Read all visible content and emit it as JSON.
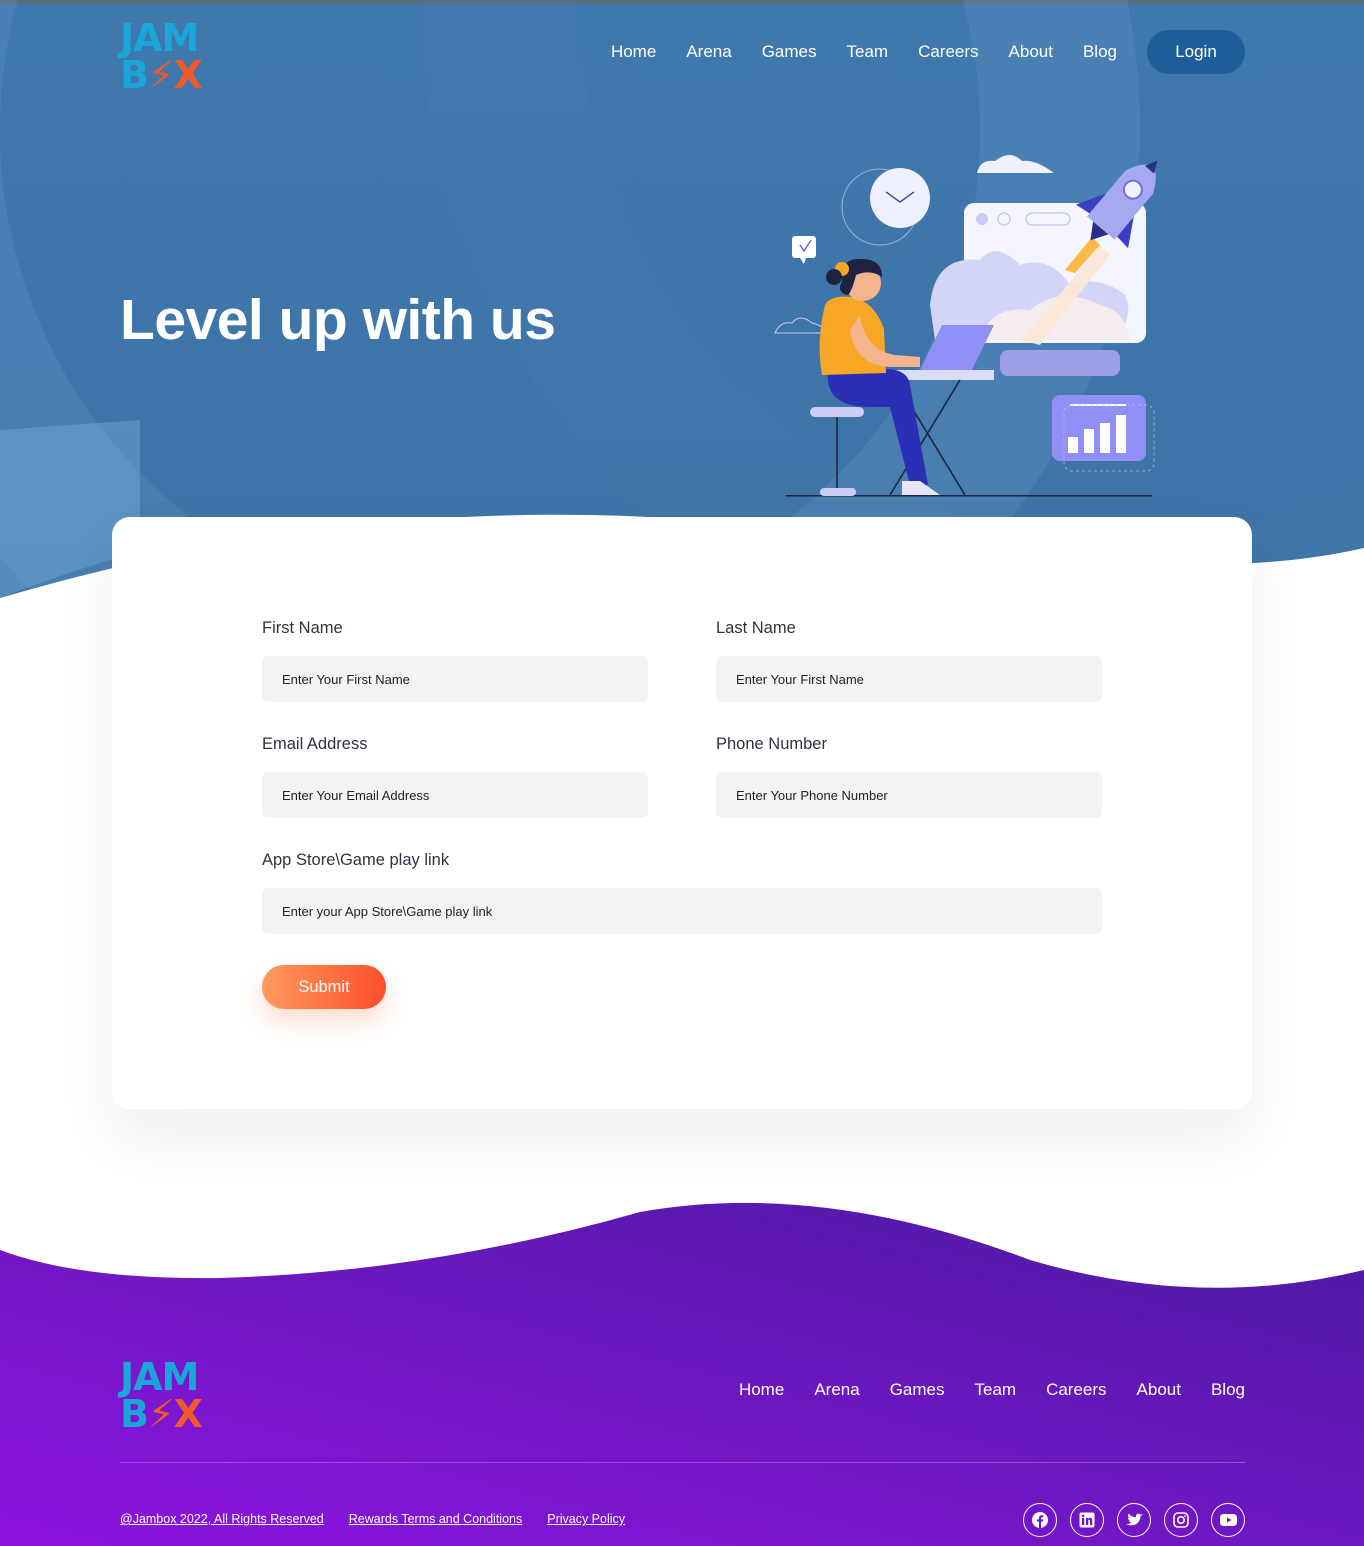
{
  "brand": {
    "line1": "JAM",
    "line2_b": "B",
    "line2_o": "⚡",
    "line2_x": "X"
  },
  "header": {
    "nav": [
      "Home",
      "Arena",
      "Games",
      "Team",
      "Careers",
      "About",
      "Blog"
    ],
    "login_label": "Login"
  },
  "hero": {
    "title": "Level up with us"
  },
  "form": {
    "first_name": {
      "label": "First Name",
      "placeholder": "Enter Your First Name"
    },
    "last_name": {
      "label": "Last Name",
      "placeholder": "Enter Your First Name"
    },
    "email": {
      "label": "Email Address",
      "placeholder": "Enter Your Email Address"
    },
    "phone": {
      "label": "Phone Number",
      "placeholder": "Enter Your Phone Number"
    },
    "app_link": {
      "label": "App Store\\Game play link",
      "placeholder": "Enter your App Store\\Game play link"
    },
    "submit_label": "Submit"
  },
  "footer": {
    "nav": [
      "Home",
      "Arena",
      "Games",
      "Team",
      "Careers",
      "About",
      "Blog"
    ],
    "copyright": "@Jambox 2022, All Rights Reserved",
    "rewards_terms": "Rewards Terms and Conditions",
    "privacy_policy": "Privacy Policy",
    "socials": [
      "facebook-icon",
      "linkedin-icon",
      "twitter-icon",
      "instagram-icon",
      "youtube-icon"
    ]
  },
  "colors": {
    "hero_blue": "#3e73a6",
    "login_bg": "#1f5d98",
    "submit_start": "#ff9a5c",
    "submit_end": "#ff4f2a",
    "footer_purple_start": "#8e14e0",
    "footer_purple_end": "#4a1aa0",
    "logo_blue": "#1aa6d8",
    "logo_orange": "#f05a28"
  }
}
